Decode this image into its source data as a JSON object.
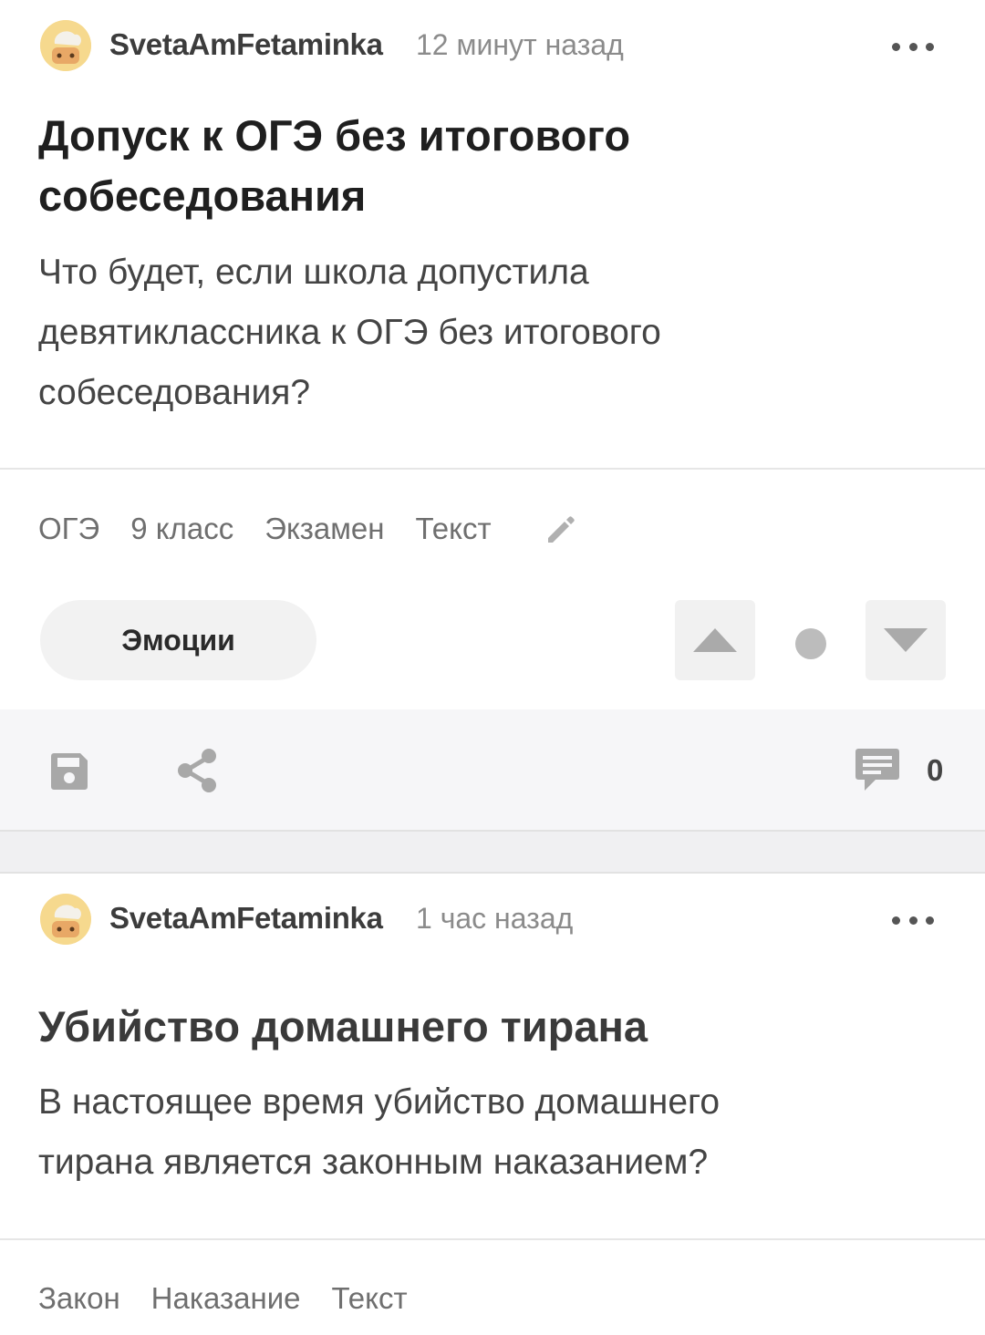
{
  "posts": [
    {
      "author": "SvetaAmFetaminka",
      "time": "12 минут назад",
      "title_lines": [
        "Допуск к ОГЭ без итогового",
        "собеседования"
      ],
      "text_lines": [
        "Что будет, если школа допустила",
        "девятиклассника к ОГЭ без итогового",
        "собеседования?"
      ],
      "tags": [
        "ОГЭ",
        "9 класс",
        "Экзамен",
        "Текст"
      ],
      "emotions_label": "Эмоции",
      "comments_count": "0",
      "icons": [
        "avatar",
        "more-icon",
        "edit-icon",
        "arrow-up-icon",
        "arrow-down-icon",
        "save-icon",
        "share-icon",
        "comments-icon"
      ]
    },
    {
      "author": "SvetaAmFetaminka",
      "time": "1 час назад",
      "title_lines": [
        "Убийство домашнего тирана"
      ],
      "text_lines": [
        "В настоящее время убийство домашнего",
        "тирана является законным наказанием?"
      ],
      "tags": [
        "Закон",
        "Наказание",
        "Текст"
      ]
    }
  ],
  "colors": {
    "text_primary": "#1f1f1f",
    "text_secondary": "#8b8b8b",
    "button_bg": "#f2f2f2",
    "action_bar_bg": "#f6f6f8",
    "icon_gray": "#a8a8a8"
  }
}
